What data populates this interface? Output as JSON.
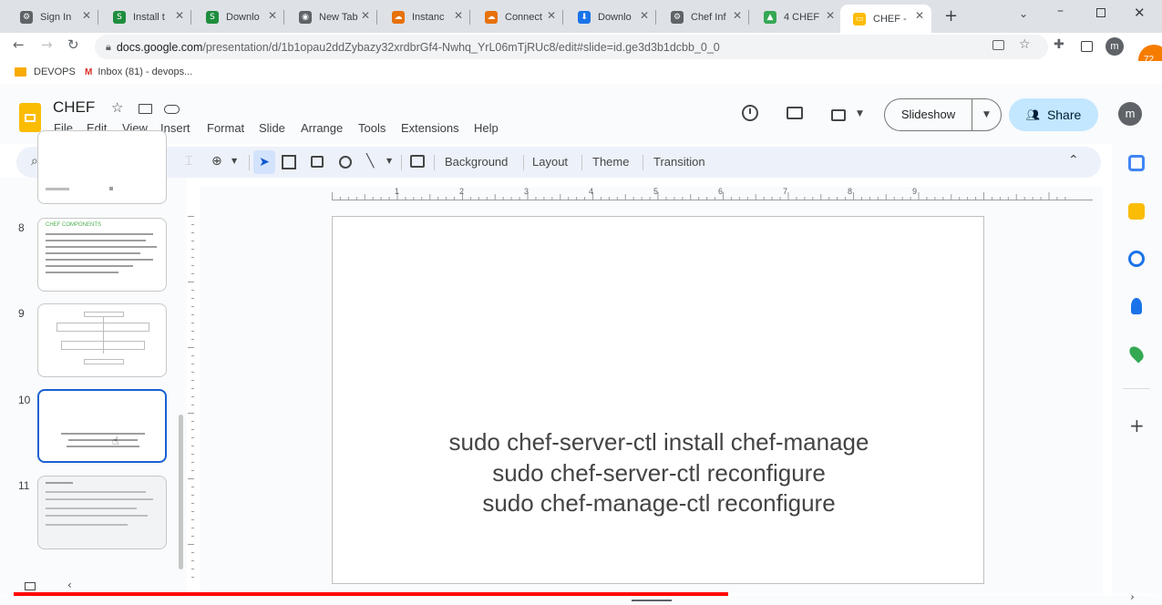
{
  "browser": {
    "tabs": [
      {
        "label": "Sign In",
        "color": "#5f6368",
        "glyph": "⚙"
      },
      {
        "label": "Install t",
        "color": "#1e8e3e",
        "glyph": "S"
      },
      {
        "label": "Downlo",
        "color": "#1e8e3e",
        "glyph": "S"
      },
      {
        "label": "New Tab",
        "color": "#5f6368",
        "glyph": "◉"
      },
      {
        "label": "Instanc",
        "color": "#e8710a",
        "glyph": "☁"
      },
      {
        "label": "Connect",
        "color": "#e8710a",
        "glyph": "☁"
      },
      {
        "label": "Downlo",
        "color": "#1a73e8",
        "glyph": "⬇"
      },
      {
        "label": "Chef Inf",
        "color": "#5f6368",
        "glyph": "⚙"
      },
      {
        "label": "4 CHEF",
        "color": "#34a853",
        "glyph": "▲"
      },
      {
        "label": "CHEF - ",
        "color": "#fbbc04",
        "glyph": "▭"
      }
    ],
    "url_host": "docs.google.com",
    "url_path": "/presentation/d/1b1opau2ddZybazy32xrdbrGf4-Nwhq_YrL06mTjRUc8/edit#slide=id.ge3d3b1dcbb_0_0",
    "bookmarks": [
      {
        "label": "DEVOPS",
        "icon": "folder-icon"
      },
      {
        "label": "Inbox (81) - devops...",
        "icon": "gmail-icon"
      }
    ],
    "profile_badge": "72"
  },
  "doc": {
    "title": "CHEF",
    "menu": [
      "File",
      "Edit",
      "View",
      "Insert",
      "Format",
      "Slide",
      "Arrange",
      "Tools",
      "Extensions",
      "Help"
    ],
    "slideshow_label": "Slideshow",
    "share_label": "Share",
    "avatar_letter": "m"
  },
  "toolbar": {
    "text_buttons": [
      "Background",
      "Layout",
      "Theme",
      "Transition"
    ]
  },
  "filmstrip": {
    "slides": [
      {
        "number": "8",
        "heading": "CHEF COMPONENTS"
      },
      {
        "number": "9"
      },
      {
        "number": "10"
      },
      {
        "number": "11"
      }
    ]
  },
  "ruler": {
    "marks": [
      "1",
      "2",
      "3",
      "4",
      "5",
      "6",
      "7",
      "8",
      "9"
    ]
  },
  "slide": {
    "lines": [
      "sudo chef-server-ctl install chef-manage",
      "sudo chef-server-ctl reconfigure",
      "sudo chef-manage-ctl reconfigure"
    ]
  },
  "video": {
    "progress": 0.63
  },
  "colors": {
    "accent": "#1a73e8",
    "share_bg": "#c2e7ff",
    "progress": "#ff0000"
  }
}
